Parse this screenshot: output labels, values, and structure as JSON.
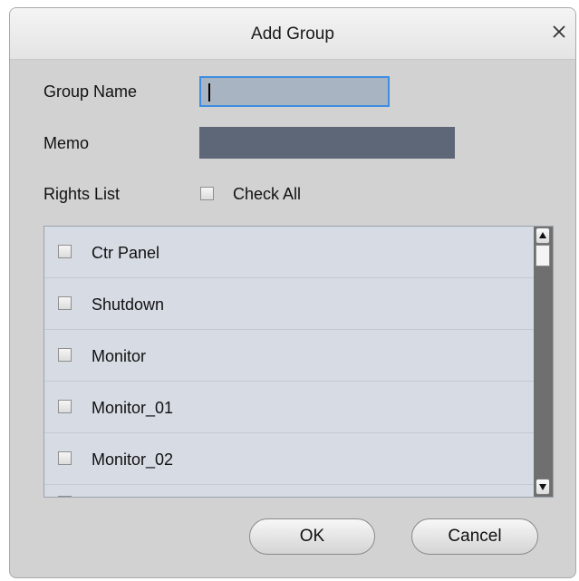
{
  "dialog": {
    "title": "Add Group",
    "close_glyph": "×"
  },
  "form": {
    "group_name_label": "Group Name",
    "group_name_value": "",
    "memo_label": "Memo",
    "memo_value": "",
    "rights_label": "Rights List",
    "check_all_label": "Check All"
  },
  "rights": [
    {
      "label": "Ctr Panel",
      "checked": false
    },
    {
      "label": "Shutdown",
      "checked": false
    },
    {
      "label": "Monitor",
      "checked": false
    },
    {
      "label": "Monitor_01",
      "checked": false
    },
    {
      "label": "Monitor_02",
      "checked": false
    }
  ],
  "buttons": {
    "ok": "OK",
    "cancel": "Cancel"
  },
  "icons": {
    "close": "close-icon",
    "scroll_up": "arrow-up-icon",
    "scroll_down": "arrow-down-icon"
  },
  "colors": {
    "focus_border": "#3d8ee0",
    "memo_fill": "#5d6778",
    "list_bg": "#dde2ea"
  }
}
